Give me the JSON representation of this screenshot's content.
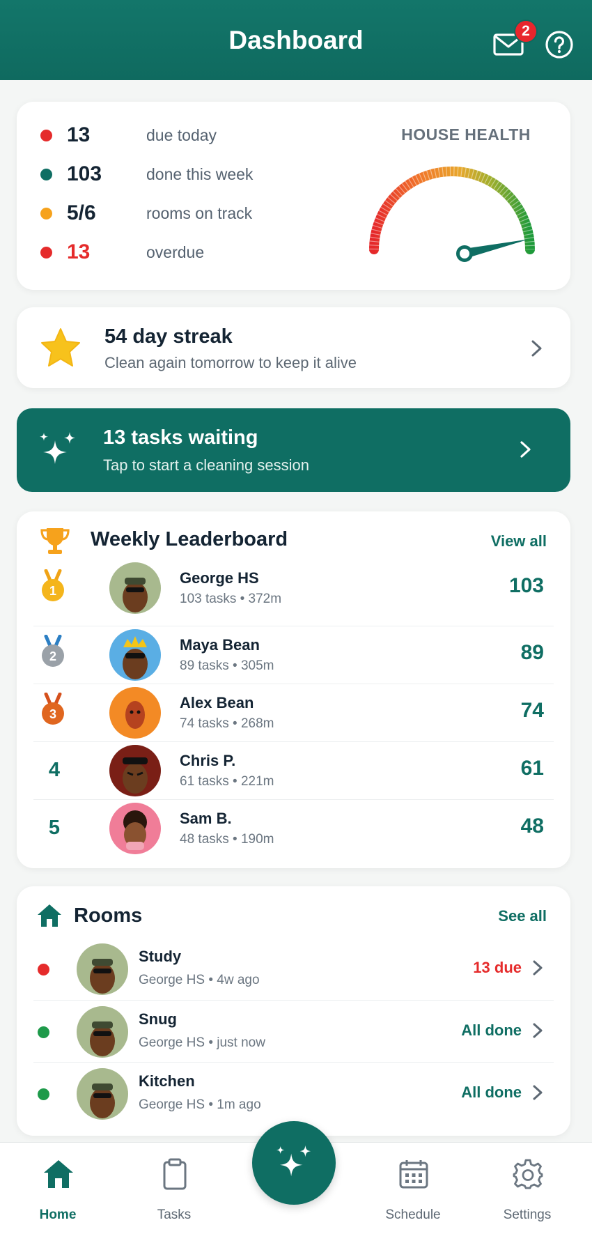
{
  "header": {
    "title": "Dashboard",
    "mail_badge": "2",
    "mail_icon": "mail-icon",
    "help_icon": "help-icon"
  },
  "stats": {
    "items": [
      {
        "value": "13",
        "label": "due today",
        "dot_color": "#e52b2b",
        "value_color": "#142433"
      },
      {
        "value": "103",
        "label": "done this week",
        "dot_color": "#0f6e63",
        "value_color": "#142433"
      },
      {
        "value": "5/6",
        "label": "rooms on track",
        "dot_color": "#f6a21c",
        "value_color": "#142433"
      },
      {
        "value": "13",
        "label": "overdue",
        "dot_color": "#e52b2b",
        "value_color": "#e52b2b"
      }
    ],
    "health_title": "HOUSE HEALTH",
    "health_level": 0.93
  },
  "streak": {
    "title": "54 day streak",
    "subtitle": "Clean again tomorrow to keep it alive",
    "icon": "star-icon"
  },
  "waiting": {
    "title": "13 tasks waiting",
    "subtitle": "Tap to start a cleaning session",
    "icon": "sparkles-icon"
  },
  "leaderboard": {
    "title": "Weekly Leaderboard",
    "view_all": "View all",
    "rows": [
      {
        "rank": "1",
        "name": "George HS",
        "meta": "103 tasks • 372m",
        "score": "103",
        "medal": "gold"
      },
      {
        "rank": "2",
        "name": "Maya Bean",
        "meta": "89 tasks • 305m",
        "score": "89",
        "medal": "silver"
      },
      {
        "rank": "3",
        "name": "Alex Bean",
        "meta": "74 tasks • 268m",
        "score": "74",
        "medal": "bronze"
      },
      {
        "rank": "4",
        "name": "Chris P.",
        "meta": "61 tasks • 221m",
        "score": "61",
        "medal": ""
      },
      {
        "rank": "5",
        "name": "Sam B.",
        "meta": "48 tasks • 190m",
        "score": "48",
        "medal": ""
      }
    ]
  },
  "rooms": {
    "title": "Rooms",
    "see_all": "See all",
    "rows": [
      {
        "name": "Study",
        "meta": "George HS • 4w ago",
        "status": "13 due",
        "dot_color": "#e52b2b",
        "status_color": "#e52b2b"
      },
      {
        "name": "Snug",
        "meta": "George HS • just now",
        "status": "All done",
        "dot_color": "#1e9a4a",
        "status_color": "#0f6e63"
      },
      {
        "name": "Kitchen",
        "meta": "George HS • 1m ago",
        "status": "All done",
        "dot_color": "#1e9a4a",
        "status_color": "#0f6e63"
      }
    ]
  },
  "nav": {
    "items": [
      {
        "label": "Home",
        "icon": "home-icon",
        "active": true
      },
      {
        "label": "Tasks",
        "icon": "clipboard-icon",
        "active": false
      },
      {
        "label": "Schedule",
        "icon": "calendar-icon",
        "active": false
      },
      {
        "label": "Settings",
        "icon": "gear-icon",
        "active": false
      }
    ],
    "fab_icon": "sparkles-icon"
  }
}
